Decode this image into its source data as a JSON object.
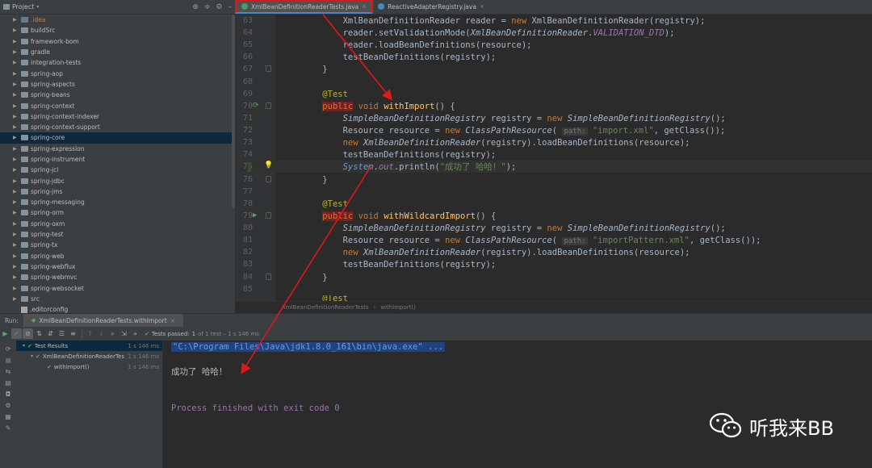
{
  "project": {
    "title": "Project",
    "items": [
      {
        "label": ".idea",
        "kind": "idea"
      },
      {
        "label": "buildSrc"
      },
      {
        "label": "framework-bom"
      },
      {
        "label": "gradle"
      },
      {
        "label": "integration-tests"
      },
      {
        "label": "spring-aop"
      },
      {
        "label": "spring-aspects"
      },
      {
        "label": "spring-beans"
      },
      {
        "label": "spring-context"
      },
      {
        "label": "spring-context-indexer"
      },
      {
        "label": "spring-context-support"
      },
      {
        "label": "spring-core",
        "selected": true
      },
      {
        "label": "spring-expression"
      },
      {
        "label": "spring-instrument"
      },
      {
        "label": "spring-jcl"
      },
      {
        "label": "spring-jdbc"
      },
      {
        "label": "spring-jms"
      },
      {
        "label": "spring-messaging"
      },
      {
        "label": "spring-orm"
      },
      {
        "label": "spring-oxm"
      },
      {
        "label": "spring-test"
      },
      {
        "label": "spring-tx"
      },
      {
        "label": "spring-web"
      },
      {
        "label": "spring-webflux"
      },
      {
        "label": "spring-webmvc"
      },
      {
        "label": "spring-websocket"
      },
      {
        "label": "src"
      },
      {
        "label": ".editorconfig",
        "kind": "file"
      }
    ]
  },
  "editor": {
    "tabs": [
      {
        "label": "XmlBeanDefinitionReaderTests.java",
        "active": true
      },
      {
        "label": "ReactiveAdapterRegistry.java",
        "active": false
      }
    ],
    "breadcrumb": [
      "XmlBeanDefinitionReaderTests",
      "withImport()"
    ]
  },
  "run": {
    "label": "Run:",
    "tab": "XmlBeanDefinitionReaderTests.withImport",
    "passed_label": "Tests passed:",
    "passed_count": "1",
    "passed_suffix": "of 1 test – 1 s 146 ms",
    "results": [
      {
        "label": "Test Results",
        "time": "1 s 146 ms",
        "indent": 0
      },
      {
        "label": "XmlBeanDefinitionReaderTes",
        "time": "1 s 146 ms",
        "indent": 1
      },
      {
        "label": "withImport()",
        "time": "1 s 146 ms",
        "indent": 2
      }
    ]
  },
  "console": {
    "cmd": "\"C:\\Program Files\\Java\\jdk1.8.0_161\\bin\\java.exe\" ...",
    "output": "成功了 哈哈！",
    "exit": "Process finished with exit code 0"
  },
  "watermark": {
    "text": "听我来BB"
  }
}
